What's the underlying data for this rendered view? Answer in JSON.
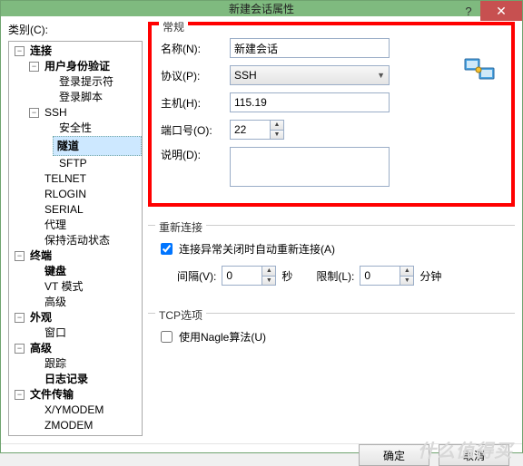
{
  "title": "新建会话属性",
  "left_label": "类别(C):",
  "tree": {
    "connection": "连接",
    "auth": "用户身份验证",
    "loginprompt": "登录提示符",
    "loginscript": "登录脚本",
    "ssh": "SSH",
    "security": "安全性",
    "tunnel": "隧道",
    "sftp": "SFTP",
    "telnet": "TELNET",
    "rlogin": "RLOGIN",
    "serial": "SERIAL",
    "proxy": "代理",
    "keepalive": "保持活动状态",
    "terminal": "终端",
    "keyboard": "键盘",
    "vtmode": "VT 模式",
    "adv": "高级",
    "appearance": "外观",
    "window": "窗口",
    "advanced2": "高级",
    "trace": "跟踪",
    "log": "日志记录",
    "filetrans": "文件传输",
    "xymodem": "X/YMODEM",
    "zmodem": "ZMODEM"
  },
  "general": {
    "title": "常规",
    "name_label": "名称(N):",
    "name_value": "新建会话",
    "proto_label": "协议(P):",
    "proto_value": "SSH",
    "host_label": "主机(H):",
    "host_value": "115.19",
    "port_label": "端口号(O):",
    "port_value": "22",
    "desc_label": "说明(D):",
    "desc_value": ""
  },
  "reconnect": {
    "title": "重新连接",
    "auto_label": "连接异常关闭时自动重新连接(A)",
    "auto_checked": true,
    "interval_label": "间隔(V):",
    "interval_value": "0",
    "interval_unit": "秒",
    "limit_label": "限制(L):",
    "limit_value": "0",
    "limit_unit": "分钟"
  },
  "tcp": {
    "title": "TCP选项",
    "nagle_label": "使用Nagle算法(U)",
    "nagle_checked": false
  },
  "footer": {
    "ok": "确定",
    "cancel": "取消"
  },
  "watermark": "什么值得买"
}
